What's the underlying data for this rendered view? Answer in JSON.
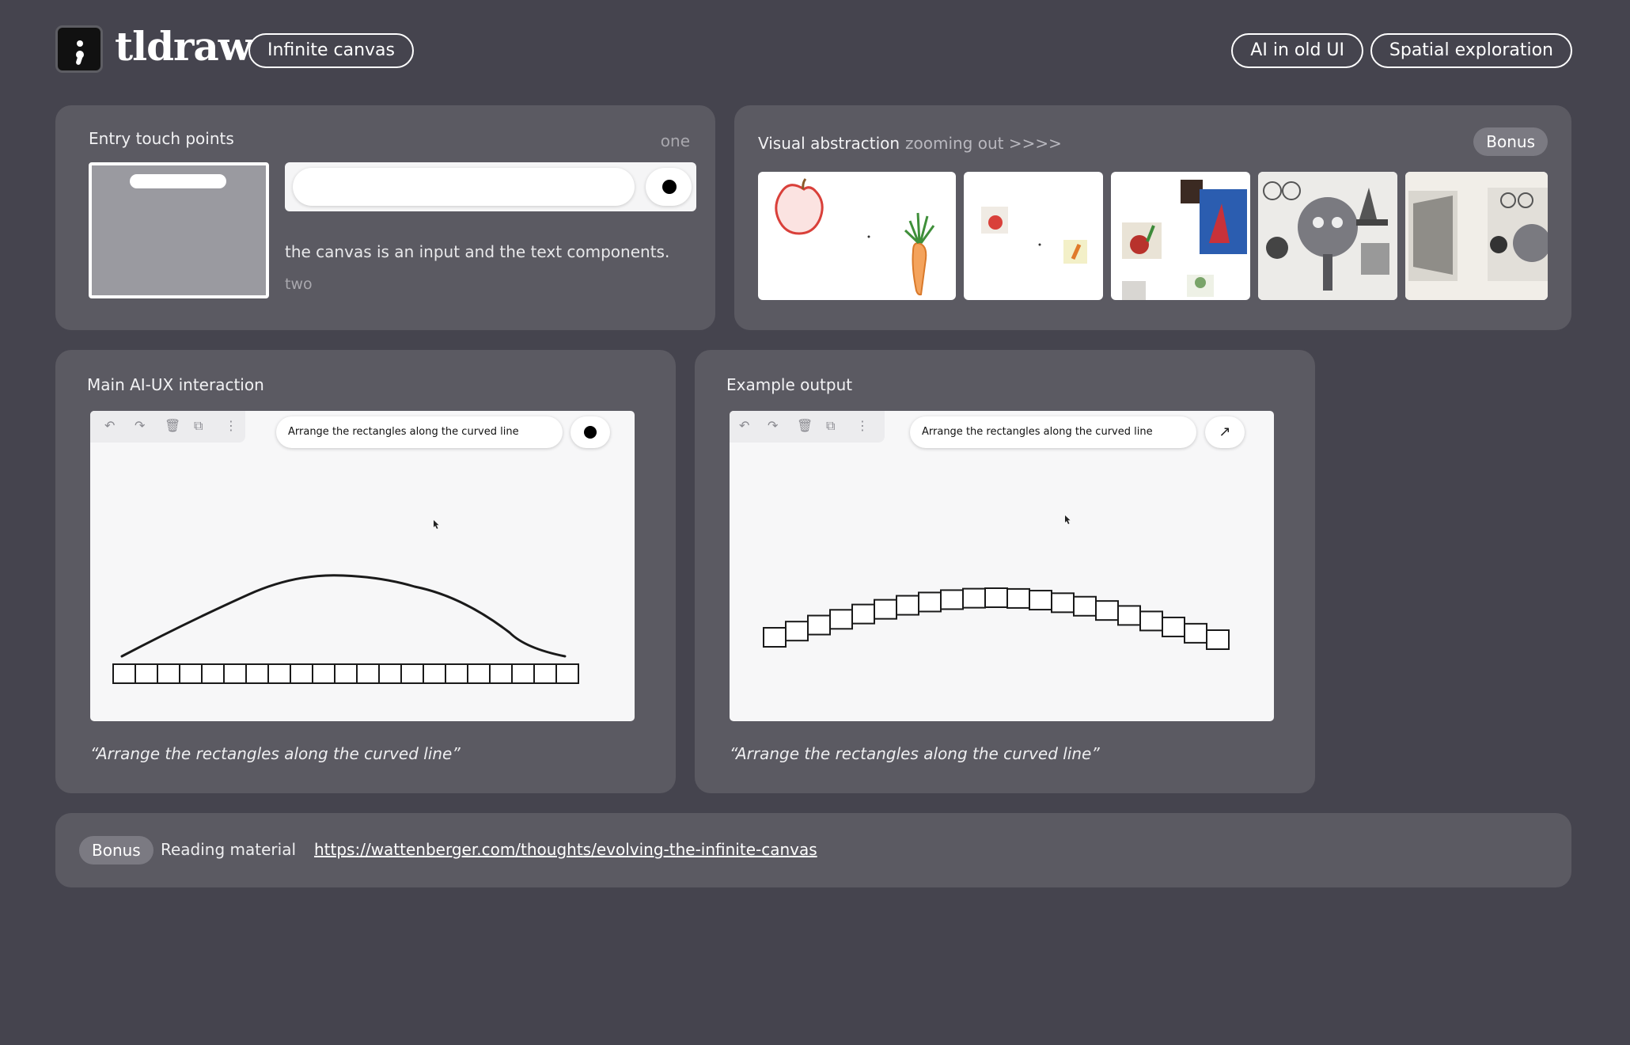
{
  "header": {
    "brand": "tldraw",
    "tag": "Infinite canvas",
    "links": [
      "AI in old UI",
      "Spatial exploration"
    ]
  },
  "entry": {
    "title": "Entry touch points",
    "step_one": "one",
    "description": "the canvas is an input and the text components.",
    "step_two": "two"
  },
  "visual": {
    "title": "Visual abstraction",
    "subtitle": "zooming out >>>>",
    "badge": "Bonus"
  },
  "main_panel": {
    "title": "Main AI-UX interaction",
    "prompt": "Arrange the rectangles along the curved line",
    "caption": "“Arrange the rectangles along the curved line”"
  },
  "example_panel": {
    "title": "Example output",
    "prompt": "Arrange the rectangles along the curved line",
    "caption": "“Arrange the rectangles along the curved line”"
  },
  "footer": {
    "badge": "Bonus",
    "label": "Reading material",
    "url": "https://wattenberger.com/thoughts/evolving-the-infinite-canvas"
  },
  "icons": {
    "undo": "undo-icon",
    "redo": "redo-icon",
    "trash": "trash-icon",
    "duplicate": "duplicate-icon",
    "more": "more-icon",
    "submit": "arrow-up-right-icon"
  }
}
